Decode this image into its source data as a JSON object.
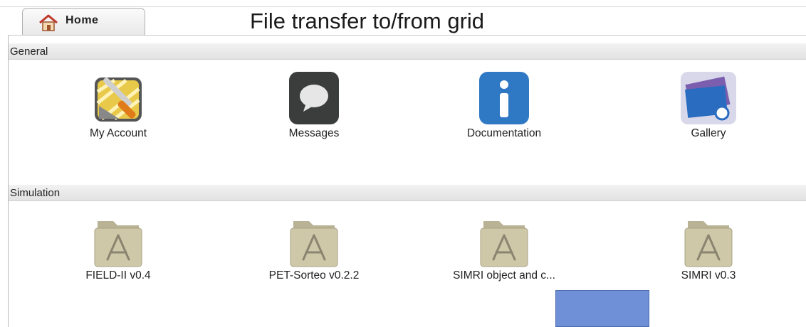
{
  "tab": {
    "label": "Home",
    "icon": "home-icon"
  },
  "overlay_title": "File transfer to/from grid",
  "sections": [
    {
      "title": "General",
      "apps": [
        {
          "label": "My Account",
          "icon": "account-tools-icon"
        },
        {
          "label": "Messages",
          "icon": "speech-bubble-icon"
        },
        {
          "label": "Documentation",
          "icon": "info-icon"
        },
        {
          "label": "Gallery",
          "icon": "gallery-icon"
        }
      ]
    },
    {
      "title": "Simulation",
      "apps": [
        {
          "label": "FIELD-II v0.4",
          "icon": "app-folder-icon"
        },
        {
          "label": "PET-Sorteo v0.2.2",
          "icon": "app-folder-icon"
        },
        {
          "label": "SIMRI object and c...",
          "icon": "app-folder-icon"
        },
        {
          "label": "SIMRI v0.3",
          "icon": "app-folder-icon"
        }
      ]
    }
  ],
  "colors": {
    "overlay_rect": "#6f8fd6",
    "doc_blue": "#2f78c4",
    "folder": "#cfc8a8"
  }
}
